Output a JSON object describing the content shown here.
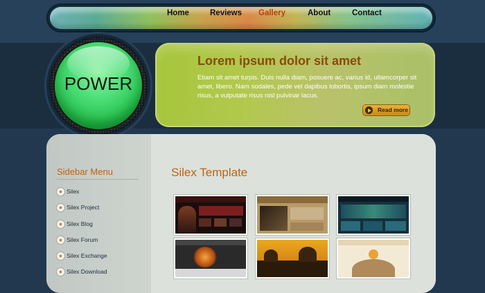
{
  "nav": {
    "items": [
      {
        "label": "Home"
      },
      {
        "label": "Reviews"
      },
      {
        "label": "Gallery",
        "active": true
      },
      {
        "label": "About"
      },
      {
        "label": "Contact"
      }
    ]
  },
  "power": {
    "label": "POWER"
  },
  "hero": {
    "title": "Lorem ipsum dolor sit amet",
    "body": "Etiam sit amet turpis. Duis nulla diam, posuere ac, varius id, ullamcorper sit amet, libero. Nam sodales, pede vel dapibus lobortis, ipsum diam molestie risus, a vulputate risus nisl pulvinar lacus.",
    "read_more": "Read more"
  },
  "sidebar": {
    "title": "Sidebar Menu",
    "items": [
      {
        "label": "Silex"
      },
      {
        "label": "Silex Project"
      },
      {
        "label": "Silex Blog"
      },
      {
        "label": "Silex Forum"
      },
      {
        "label": "Silex Exchange"
      },
      {
        "label": "Silex Download"
      }
    ]
  },
  "main": {
    "title": "Silex Template"
  },
  "colors": {
    "accent_orange": "#c1620f",
    "active_nav": "#b5410a",
    "hero_green": "#a6c63c",
    "power_green": "#4ee07a",
    "page_bg": "#22384f"
  }
}
